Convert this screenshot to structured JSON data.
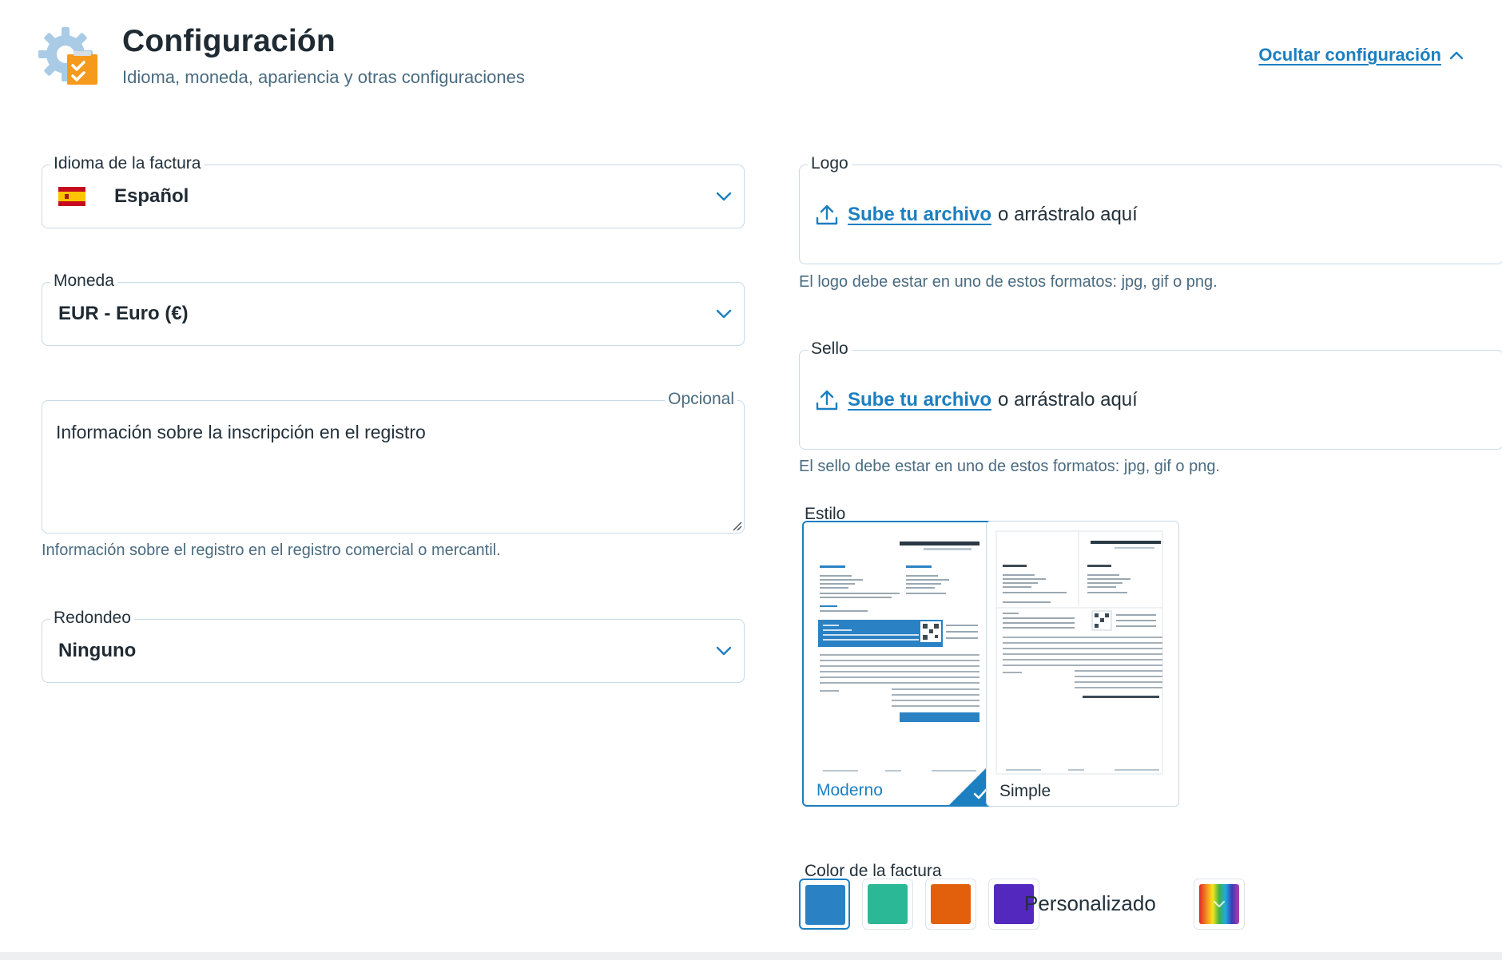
{
  "header": {
    "title": "Configuración",
    "subtitle": "Idioma, moneda, apariencia y otras configuraciones",
    "hide_link": "Ocultar configuración",
    "icon": "settings-gear-checklist-icon"
  },
  "left": {
    "language": {
      "label": "Idioma de la factura",
      "value": "Español",
      "flag": "spain-flag-icon"
    },
    "currency": {
      "label": "Moneda",
      "value": "EUR - Euro (€)"
    },
    "registration": {
      "optional_label": "Opcional",
      "placeholder": "Información sobre la inscripción en el registro",
      "hint": "Información sobre el registro en el registro comercial o mercantil."
    },
    "rounding": {
      "label": "Redondeo",
      "value": "Ninguno"
    }
  },
  "right": {
    "logo": {
      "label": "Logo",
      "upload_link": "Sube tu archivo",
      "upload_rest": "o arrástralo aquí",
      "hint": "El logo debe estar en uno de estos formatos: jpg, gif o png."
    },
    "stamp": {
      "label": "Sello",
      "upload_link": "Sube tu archivo",
      "upload_rest": "o arrástralo aquí",
      "hint": "El sello debe estar en uno de estos formatos: jpg, gif o png."
    },
    "style": {
      "label": "Estilo",
      "options": [
        {
          "name": "Moderno",
          "selected": true
        },
        {
          "name": "Simple",
          "selected": false
        }
      ]
    },
    "color": {
      "label": "Color de la factura",
      "swatches": [
        {
          "name": "blue",
          "hex": "#2a82c4",
          "selected": true
        },
        {
          "name": "teal",
          "hex": "#2bb896",
          "selected": false
        },
        {
          "name": "orange",
          "hex": "#e2600c",
          "selected": false
        },
        {
          "name": "purple",
          "hex": "#5228bf",
          "selected": false
        }
      ],
      "custom_label": "Personalizado"
    }
  },
  "colors": {
    "accent": "#1c7fc0",
    "border": "#c9d9e6",
    "muted_text": "#4a6b80"
  }
}
